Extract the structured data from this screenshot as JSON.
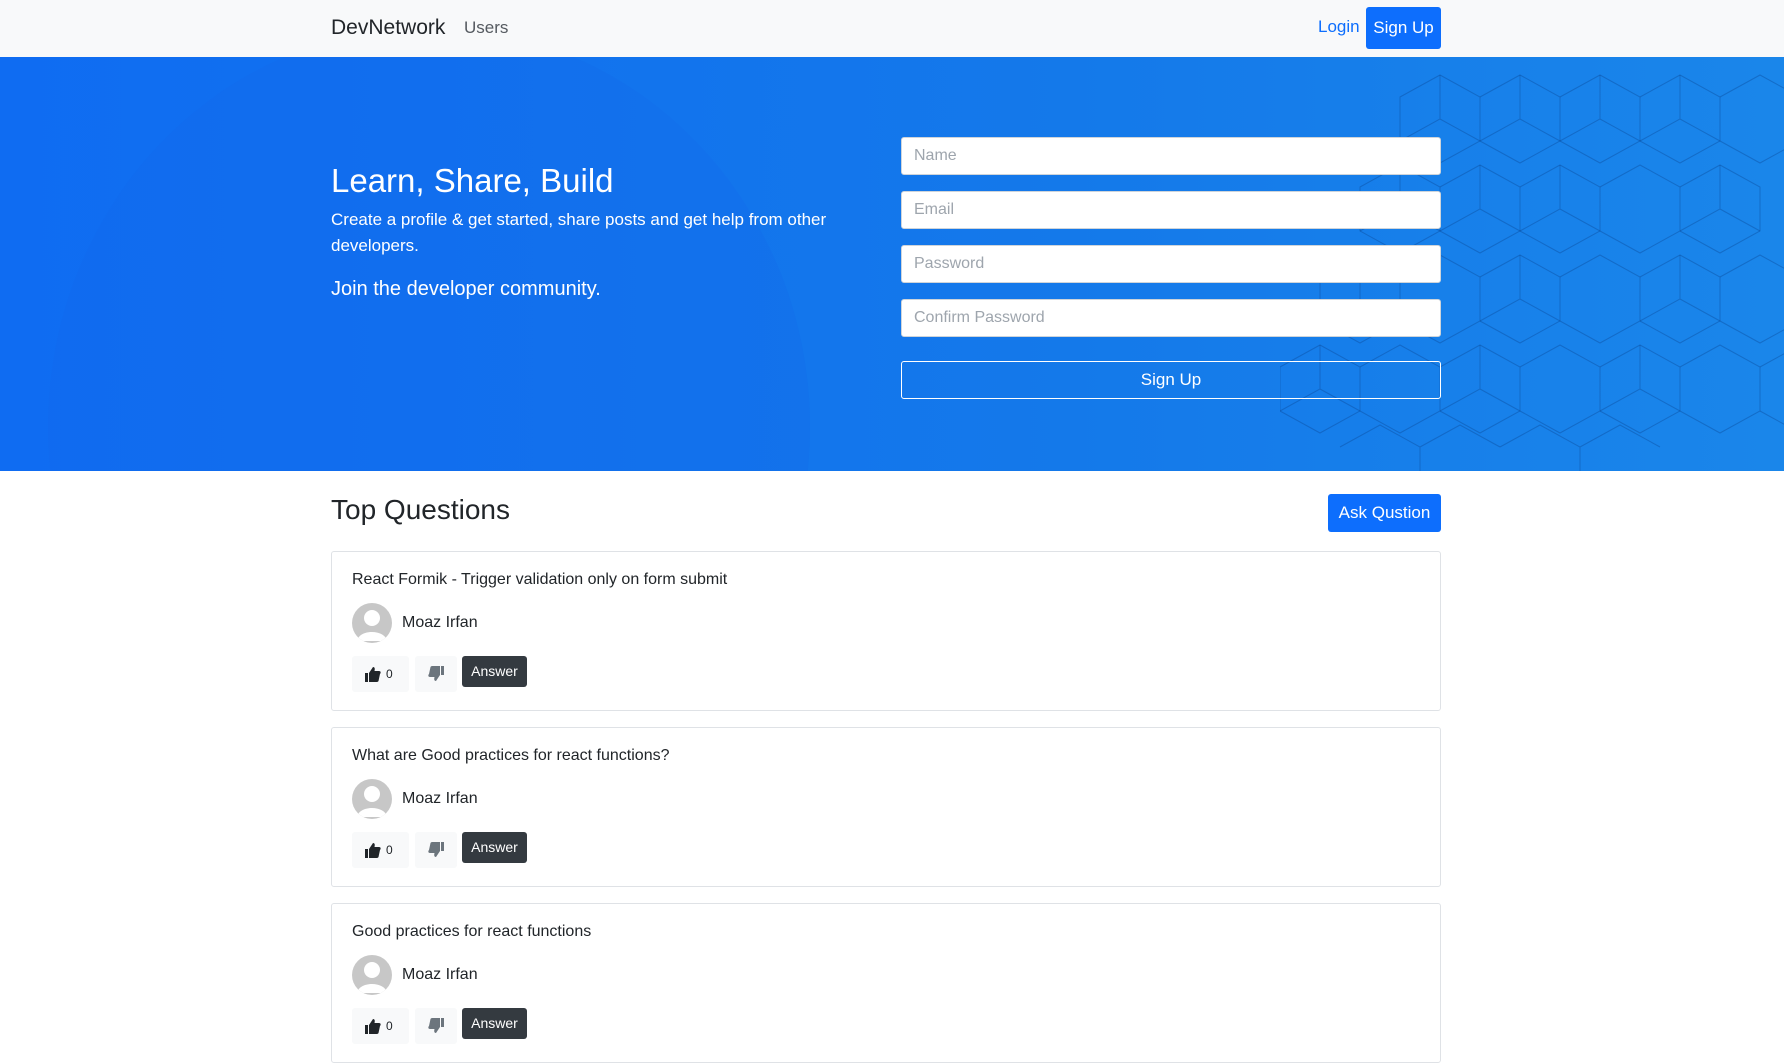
{
  "navbar": {
    "brand": "DevNetwork",
    "links": {
      "users": "Users",
      "login": "Login",
      "signup": "Sign Up"
    }
  },
  "hero": {
    "title": "Learn, Share, Build",
    "description": "Create a profile & get started, share posts and get help from other developers.",
    "join": "Join the developer community.",
    "form": {
      "name_placeholder": "Name",
      "email_placeholder": "Email",
      "password_placeholder": "Password",
      "confirm_password_placeholder": "Confirm Password",
      "submit_label": "Sign Up"
    }
  },
  "questions": {
    "title": "Top Questions",
    "ask_label": "Ask Qustion",
    "items": [
      {
        "title": "React Formik - Trigger validation only on form submit",
        "author": "Moaz Irfan",
        "likes": "0",
        "answer_label": "Answer"
      },
      {
        "title": "What are Good practices for react functions?",
        "author": "Moaz Irfan",
        "likes": "0",
        "answer_label": "Answer"
      },
      {
        "title": "Good practices for react functions",
        "author": "Moaz Irfan",
        "likes": "0",
        "answer_label": "Answer"
      }
    ]
  },
  "icons": {
    "like": "thumbs-up-icon",
    "dislike": "thumbs-down-icon",
    "avatar": "user-avatar-icon"
  },
  "colors": {
    "primary": "#0d6efd",
    "hero": "#1479ea",
    "dark_button": "#343a40",
    "navbar": "#f8f9fa"
  }
}
